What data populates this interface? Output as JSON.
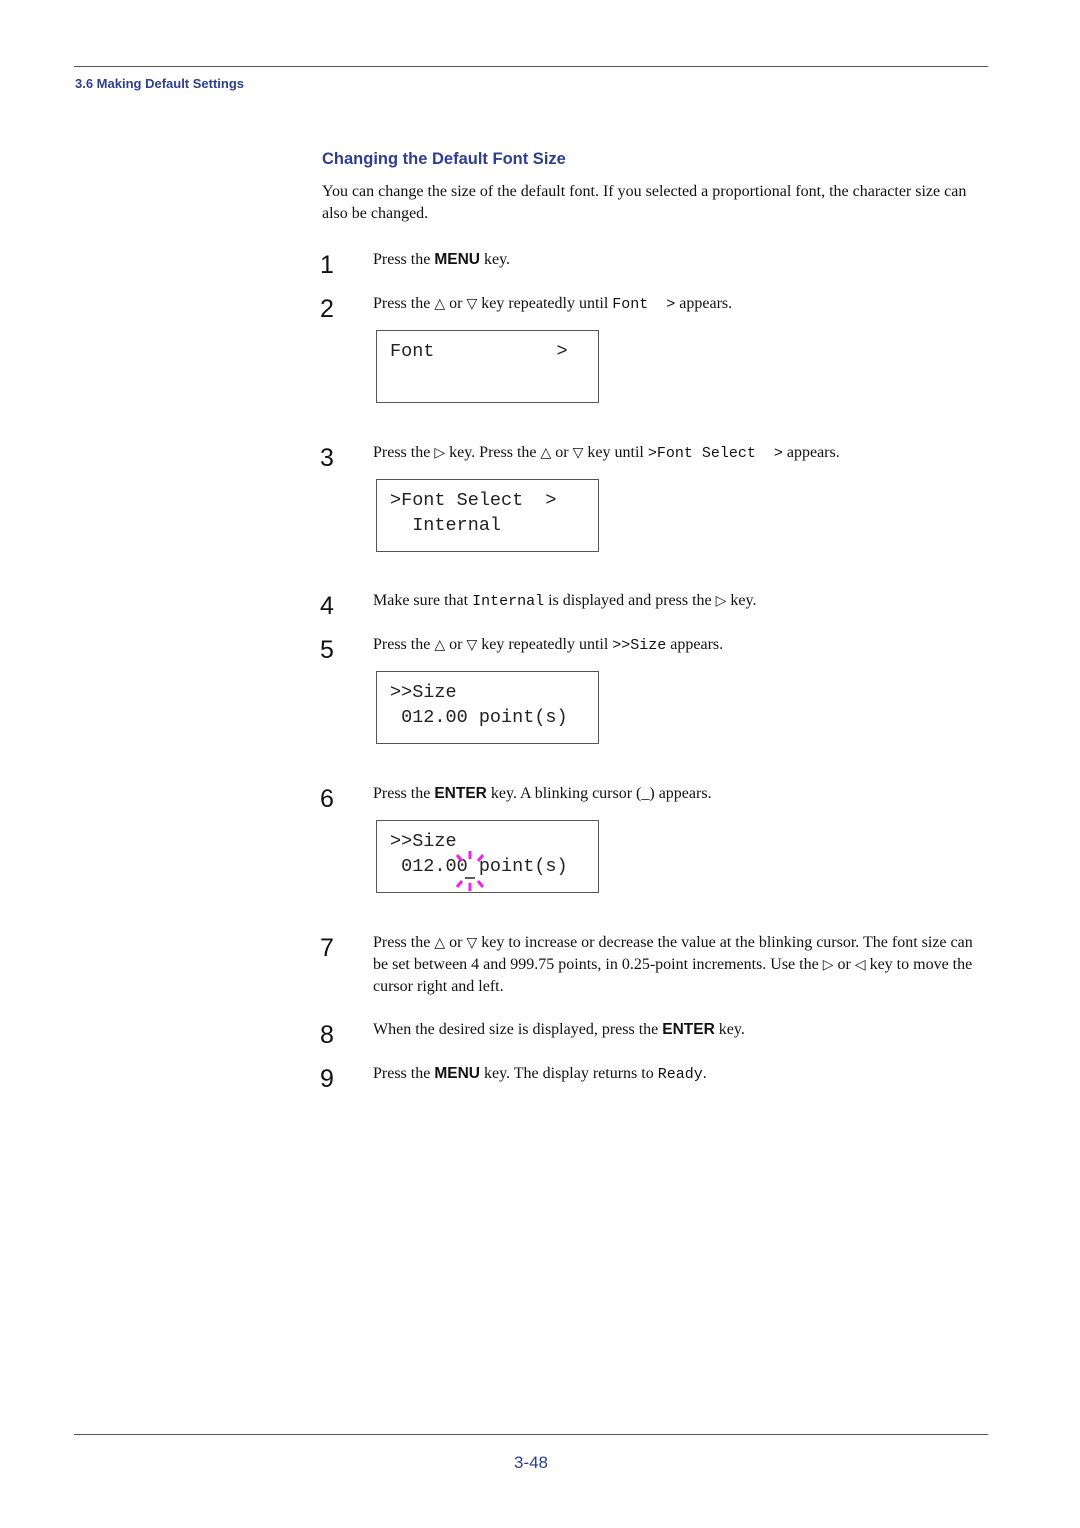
{
  "header": {
    "section": "3.6 Making Default Settings"
  },
  "heading": "Changing the Default Font Size",
  "intro": "You can change the size of the default font. If you selected a proportional font, the character size can also be changed.",
  "icons": {
    "up": "△",
    "down": "▽",
    "right": "▷",
    "left": "◁"
  },
  "steps": [
    {
      "num": "1",
      "t1": "Press the ",
      "key": "MENU",
      "t2": " key."
    },
    {
      "num": "2",
      "t1": "Press the ",
      "t2": " or ",
      "t3": " key repeatedly until ",
      "code": "Font  >",
      "t4": " appears."
    },
    {
      "num": "3",
      "t1": "Press the ",
      "t2": " key. Press the ",
      "t3": " or ",
      "t4": " key until ",
      "code": ">Font Select  >",
      "t5": " appears."
    },
    {
      "num": "4",
      "t1": "Make sure that ",
      "code": "Internal",
      "t2": " is displayed and press the ",
      "t3": " key."
    },
    {
      "num": "5",
      "t1": "Press the ",
      "t2": " or ",
      "t3": " key repeatedly until ",
      "code": ">>Size",
      "t4": " appears."
    },
    {
      "num": "6",
      "t1": "Press the ",
      "key": "ENTER",
      "t2": " key. A blinking cursor (_) appears."
    },
    {
      "num": "7",
      "t1": "Press the ",
      "t2": " or ",
      "t3": " key to increase or decrease the value at the blinking cursor. The font size can be set between 4 and 999.75 points, in 0.25-point increments. Use the ",
      "t4": " or ",
      "t5": " key to move the cursor right and left."
    },
    {
      "num": "8",
      "t1": "When the desired size is displayed, press the ",
      "key": "ENTER",
      "t2": " key."
    },
    {
      "num": "9",
      "t1": "Press the ",
      "key": "MENU",
      "t2": " key. The display returns to ",
      "code": "Ready",
      "t3": "."
    }
  ],
  "displays": [
    {
      "line1": "Font           >",
      "line2": ""
    },
    {
      "line1": ">Font Select  >",
      "line2": "  Internal"
    },
    {
      "line1": ">>Size",
      "line2": " 012.00 point(s)"
    },
    {
      "line1": ">>Size",
      "line2": " 012.00 point(s)"
    }
  ],
  "cursor_color": "#ee22ee",
  "footer": {
    "page_number": "3-48"
  }
}
